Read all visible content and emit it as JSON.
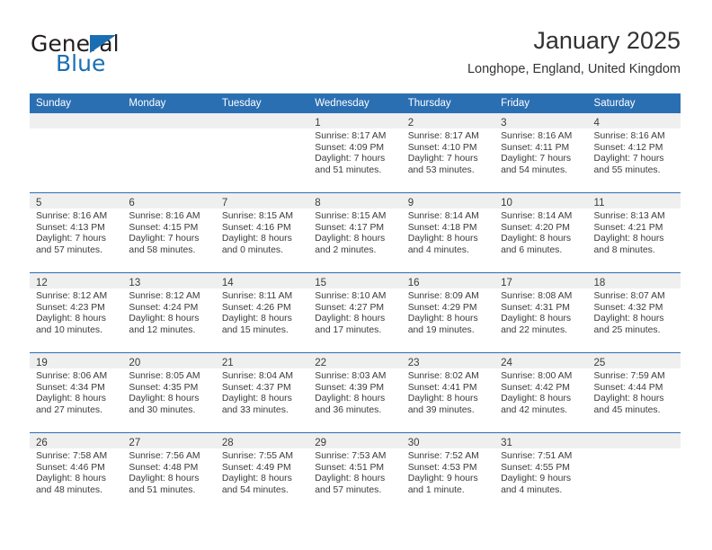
{
  "logo": {
    "word_one": "General",
    "word_two": "Blue",
    "triangle_color": "#1a6fb4",
    "word_one_color": "#231f20",
    "word_two_color": "#1a6fb4"
  },
  "header": {
    "title": "January 2025",
    "subtitle": "Longhope, England, United Kingdom"
  },
  "theme": {
    "header_bar_color": "#2b6fb3",
    "daynum_band_color": "#efefef",
    "row_divider_color": "#2b6fb3",
    "text_color": "#3b3b3b"
  },
  "weekdays": [
    "Sunday",
    "Monday",
    "Tuesday",
    "Wednesday",
    "Thursday",
    "Friday",
    "Saturday"
  ],
  "weeks": [
    [
      {
        "empty": true
      },
      {
        "empty": true
      },
      {
        "empty": true
      },
      {
        "day": "1",
        "sunrise": "Sunrise: 8:17 AM",
        "sunset": "Sunset: 4:09 PM",
        "daylight1": "Daylight: 7 hours",
        "daylight2": "and 51 minutes."
      },
      {
        "day": "2",
        "sunrise": "Sunrise: 8:17 AM",
        "sunset": "Sunset: 4:10 PM",
        "daylight1": "Daylight: 7 hours",
        "daylight2": "and 53 minutes."
      },
      {
        "day": "3",
        "sunrise": "Sunrise: 8:16 AM",
        "sunset": "Sunset: 4:11 PM",
        "daylight1": "Daylight: 7 hours",
        "daylight2": "and 54 minutes."
      },
      {
        "day": "4",
        "sunrise": "Sunrise: 8:16 AM",
        "sunset": "Sunset: 4:12 PM",
        "daylight1": "Daylight: 7 hours",
        "daylight2": "and 55 minutes."
      }
    ],
    [
      {
        "day": "5",
        "sunrise": "Sunrise: 8:16 AM",
        "sunset": "Sunset: 4:13 PM",
        "daylight1": "Daylight: 7 hours",
        "daylight2": "and 57 minutes."
      },
      {
        "day": "6",
        "sunrise": "Sunrise: 8:16 AM",
        "sunset": "Sunset: 4:15 PM",
        "daylight1": "Daylight: 7 hours",
        "daylight2": "and 58 minutes."
      },
      {
        "day": "7",
        "sunrise": "Sunrise: 8:15 AM",
        "sunset": "Sunset: 4:16 PM",
        "daylight1": "Daylight: 8 hours",
        "daylight2": "and 0 minutes."
      },
      {
        "day": "8",
        "sunrise": "Sunrise: 8:15 AM",
        "sunset": "Sunset: 4:17 PM",
        "daylight1": "Daylight: 8 hours",
        "daylight2": "and 2 minutes."
      },
      {
        "day": "9",
        "sunrise": "Sunrise: 8:14 AM",
        "sunset": "Sunset: 4:18 PM",
        "daylight1": "Daylight: 8 hours",
        "daylight2": "and 4 minutes."
      },
      {
        "day": "10",
        "sunrise": "Sunrise: 8:14 AM",
        "sunset": "Sunset: 4:20 PM",
        "daylight1": "Daylight: 8 hours",
        "daylight2": "and 6 minutes."
      },
      {
        "day": "11",
        "sunrise": "Sunrise: 8:13 AM",
        "sunset": "Sunset: 4:21 PM",
        "daylight1": "Daylight: 8 hours",
        "daylight2": "and 8 minutes."
      }
    ],
    [
      {
        "day": "12",
        "sunrise": "Sunrise: 8:12 AM",
        "sunset": "Sunset: 4:23 PM",
        "daylight1": "Daylight: 8 hours",
        "daylight2": "and 10 minutes."
      },
      {
        "day": "13",
        "sunrise": "Sunrise: 8:12 AM",
        "sunset": "Sunset: 4:24 PM",
        "daylight1": "Daylight: 8 hours",
        "daylight2": "and 12 minutes."
      },
      {
        "day": "14",
        "sunrise": "Sunrise: 8:11 AM",
        "sunset": "Sunset: 4:26 PM",
        "daylight1": "Daylight: 8 hours",
        "daylight2": "and 15 minutes."
      },
      {
        "day": "15",
        "sunrise": "Sunrise: 8:10 AM",
        "sunset": "Sunset: 4:27 PM",
        "daylight1": "Daylight: 8 hours",
        "daylight2": "and 17 minutes."
      },
      {
        "day": "16",
        "sunrise": "Sunrise: 8:09 AM",
        "sunset": "Sunset: 4:29 PM",
        "daylight1": "Daylight: 8 hours",
        "daylight2": "and 19 minutes."
      },
      {
        "day": "17",
        "sunrise": "Sunrise: 8:08 AM",
        "sunset": "Sunset: 4:31 PM",
        "daylight1": "Daylight: 8 hours",
        "daylight2": "and 22 minutes."
      },
      {
        "day": "18",
        "sunrise": "Sunrise: 8:07 AM",
        "sunset": "Sunset: 4:32 PM",
        "daylight1": "Daylight: 8 hours",
        "daylight2": "and 25 minutes."
      }
    ],
    [
      {
        "day": "19",
        "sunrise": "Sunrise: 8:06 AM",
        "sunset": "Sunset: 4:34 PM",
        "daylight1": "Daylight: 8 hours",
        "daylight2": "and 27 minutes."
      },
      {
        "day": "20",
        "sunrise": "Sunrise: 8:05 AM",
        "sunset": "Sunset: 4:35 PM",
        "daylight1": "Daylight: 8 hours",
        "daylight2": "and 30 minutes."
      },
      {
        "day": "21",
        "sunrise": "Sunrise: 8:04 AM",
        "sunset": "Sunset: 4:37 PM",
        "daylight1": "Daylight: 8 hours",
        "daylight2": "and 33 minutes."
      },
      {
        "day": "22",
        "sunrise": "Sunrise: 8:03 AM",
        "sunset": "Sunset: 4:39 PM",
        "daylight1": "Daylight: 8 hours",
        "daylight2": "and 36 minutes."
      },
      {
        "day": "23",
        "sunrise": "Sunrise: 8:02 AM",
        "sunset": "Sunset: 4:41 PM",
        "daylight1": "Daylight: 8 hours",
        "daylight2": "and 39 minutes."
      },
      {
        "day": "24",
        "sunrise": "Sunrise: 8:00 AM",
        "sunset": "Sunset: 4:42 PM",
        "daylight1": "Daylight: 8 hours",
        "daylight2": "and 42 minutes."
      },
      {
        "day": "25",
        "sunrise": "Sunrise: 7:59 AM",
        "sunset": "Sunset: 4:44 PM",
        "daylight1": "Daylight: 8 hours",
        "daylight2": "and 45 minutes."
      }
    ],
    [
      {
        "day": "26",
        "sunrise": "Sunrise: 7:58 AM",
        "sunset": "Sunset: 4:46 PM",
        "daylight1": "Daylight: 8 hours",
        "daylight2": "and 48 minutes."
      },
      {
        "day": "27",
        "sunrise": "Sunrise: 7:56 AM",
        "sunset": "Sunset: 4:48 PM",
        "daylight1": "Daylight: 8 hours",
        "daylight2": "and 51 minutes."
      },
      {
        "day": "28",
        "sunrise": "Sunrise: 7:55 AM",
        "sunset": "Sunset: 4:49 PM",
        "daylight1": "Daylight: 8 hours",
        "daylight2": "and 54 minutes."
      },
      {
        "day": "29",
        "sunrise": "Sunrise: 7:53 AM",
        "sunset": "Sunset: 4:51 PM",
        "daylight1": "Daylight: 8 hours",
        "daylight2": "and 57 minutes."
      },
      {
        "day": "30",
        "sunrise": "Sunrise: 7:52 AM",
        "sunset": "Sunset: 4:53 PM",
        "daylight1": "Daylight: 9 hours",
        "daylight2": "and 1 minute."
      },
      {
        "day": "31",
        "sunrise": "Sunrise: 7:51 AM",
        "sunset": "Sunset: 4:55 PM",
        "daylight1": "Daylight: 9 hours",
        "daylight2": "and 4 minutes."
      },
      {
        "empty": true
      }
    ]
  ]
}
